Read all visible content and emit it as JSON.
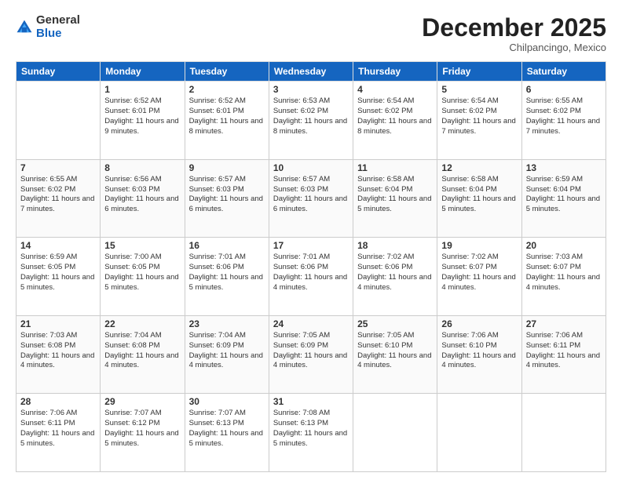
{
  "header": {
    "logo_general": "General",
    "logo_blue": "Blue",
    "month": "December 2025",
    "location": "Chilpancingo, Mexico"
  },
  "columns": [
    "Sunday",
    "Monday",
    "Tuesday",
    "Wednesday",
    "Thursday",
    "Friday",
    "Saturday"
  ],
  "weeks": [
    [
      {
        "day": "",
        "sunrise": "",
        "sunset": "",
        "daylight": ""
      },
      {
        "day": "1",
        "sunrise": "Sunrise: 6:52 AM",
        "sunset": "Sunset: 6:01 PM",
        "daylight": "Daylight: 11 hours and 9 minutes."
      },
      {
        "day": "2",
        "sunrise": "Sunrise: 6:52 AM",
        "sunset": "Sunset: 6:01 PM",
        "daylight": "Daylight: 11 hours and 8 minutes."
      },
      {
        "day": "3",
        "sunrise": "Sunrise: 6:53 AM",
        "sunset": "Sunset: 6:02 PM",
        "daylight": "Daylight: 11 hours and 8 minutes."
      },
      {
        "day": "4",
        "sunrise": "Sunrise: 6:54 AM",
        "sunset": "Sunset: 6:02 PM",
        "daylight": "Daylight: 11 hours and 8 minutes."
      },
      {
        "day": "5",
        "sunrise": "Sunrise: 6:54 AM",
        "sunset": "Sunset: 6:02 PM",
        "daylight": "Daylight: 11 hours and 7 minutes."
      },
      {
        "day": "6",
        "sunrise": "Sunrise: 6:55 AM",
        "sunset": "Sunset: 6:02 PM",
        "daylight": "Daylight: 11 hours and 7 minutes."
      }
    ],
    [
      {
        "day": "7",
        "sunrise": "Sunrise: 6:55 AM",
        "sunset": "Sunset: 6:02 PM",
        "daylight": "Daylight: 11 hours and 7 minutes."
      },
      {
        "day": "8",
        "sunrise": "Sunrise: 6:56 AM",
        "sunset": "Sunset: 6:03 PM",
        "daylight": "Daylight: 11 hours and 6 minutes."
      },
      {
        "day": "9",
        "sunrise": "Sunrise: 6:57 AM",
        "sunset": "Sunset: 6:03 PM",
        "daylight": "Daylight: 11 hours and 6 minutes."
      },
      {
        "day": "10",
        "sunrise": "Sunrise: 6:57 AM",
        "sunset": "Sunset: 6:03 PM",
        "daylight": "Daylight: 11 hours and 6 minutes."
      },
      {
        "day": "11",
        "sunrise": "Sunrise: 6:58 AM",
        "sunset": "Sunset: 6:04 PM",
        "daylight": "Daylight: 11 hours and 5 minutes."
      },
      {
        "day": "12",
        "sunrise": "Sunrise: 6:58 AM",
        "sunset": "Sunset: 6:04 PM",
        "daylight": "Daylight: 11 hours and 5 minutes."
      },
      {
        "day": "13",
        "sunrise": "Sunrise: 6:59 AM",
        "sunset": "Sunset: 6:04 PM",
        "daylight": "Daylight: 11 hours and 5 minutes."
      }
    ],
    [
      {
        "day": "14",
        "sunrise": "Sunrise: 6:59 AM",
        "sunset": "Sunset: 6:05 PM",
        "daylight": "Daylight: 11 hours and 5 minutes."
      },
      {
        "day": "15",
        "sunrise": "Sunrise: 7:00 AM",
        "sunset": "Sunset: 6:05 PM",
        "daylight": "Daylight: 11 hours and 5 minutes."
      },
      {
        "day": "16",
        "sunrise": "Sunrise: 7:01 AM",
        "sunset": "Sunset: 6:06 PM",
        "daylight": "Daylight: 11 hours and 5 minutes."
      },
      {
        "day": "17",
        "sunrise": "Sunrise: 7:01 AM",
        "sunset": "Sunset: 6:06 PM",
        "daylight": "Daylight: 11 hours and 4 minutes."
      },
      {
        "day": "18",
        "sunrise": "Sunrise: 7:02 AM",
        "sunset": "Sunset: 6:06 PM",
        "daylight": "Daylight: 11 hours and 4 minutes."
      },
      {
        "day": "19",
        "sunrise": "Sunrise: 7:02 AM",
        "sunset": "Sunset: 6:07 PM",
        "daylight": "Daylight: 11 hours and 4 minutes."
      },
      {
        "day": "20",
        "sunrise": "Sunrise: 7:03 AM",
        "sunset": "Sunset: 6:07 PM",
        "daylight": "Daylight: 11 hours and 4 minutes."
      }
    ],
    [
      {
        "day": "21",
        "sunrise": "Sunrise: 7:03 AM",
        "sunset": "Sunset: 6:08 PM",
        "daylight": "Daylight: 11 hours and 4 minutes."
      },
      {
        "day": "22",
        "sunrise": "Sunrise: 7:04 AM",
        "sunset": "Sunset: 6:08 PM",
        "daylight": "Daylight: 11 hours and 4 minutes."
      },
      {
        "day": "23",
        "sunrise": "Sunrise: 7:04 AM",
        "sunset": "Sunset: 6:09 PM",
        "daylight": "Daylight: 11 hours and 4 minutes."
      },
      {
        "day": "24",
        "sunrise": "Sunrise: 7:05 AM",
        "sunset": "Sunset: 6:09 PM",
        "daylight": "Daylight: 11 hours and 4 minutes."
      },
      {
        "day": "25",
        "sunrise": "Sunrise: 7:05 AM",
        "sunset": "Sunset: 6:10 PM",
        "daylight": "Daylight: 11 hours and 4 minutes."
      },
      {
        "day": "26",
        "sunrise": "Sunrise: 7:06 AM",
        "sunset": "Sunset: 6:10 PM",
        "daylight": "Daylight: 11 hours and 4 minutes."
      },
      {
        "day": "27",
        "sunrise": "Sunrise: 7:06 AM",
        "sunset": "Sunset: 6:11 PM",
        "daylight": "Daylight: 11 hours and 4 minutes."
      }
    ],
    [
      {
        "day": "28",
        "sunrise": "Sunrise: 7:06 AM",
        "sunset": "Sunset: 6:11 PM",
        "daylight": "Daylight: 11 hours and 5 minutes."
      },
      {
        "day": "29",
        "sunrise": "Sunrise: 7:07 AM",
        "sunset": "Sunset: 6:12 PM",
        "daylight": "Daylight: 11 hours and 5 minutes."
      },
      {
        "day": "30",
        "sunrise": "Sunrise: 7:07 AM",
        "sunset": "Sunset: 6:13 PM",
        "daylight": "Daylight: 11 hours and 5 minutes."
      },
      {
        "day": "31",
        "sunrise": "Sunrise: 7:08 AM",
        "sunset": "Sunset: 6:13 PM",
        "daylight": "Daylight: 11 hours and 5 minutes."
      },
      {
        "day": "",
        "sunrise": "",
        "sunset": "",
        "daylight": ""
      },
      {
        "day": "",
        "sunrise": "",
        "sunset": "",
        "daylight": ""
      },
      {
        "day": "",
        "sunrise": "",
        "sunset": "",
        "daylight": ""
      }
    ]
  ]
}
